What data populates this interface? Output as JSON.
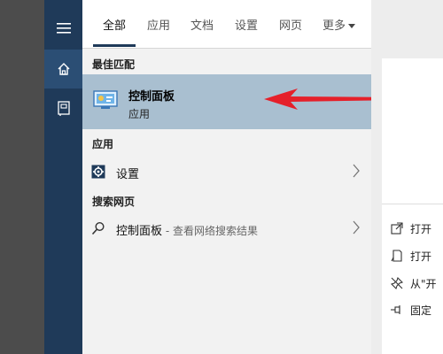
{
  "tabs": {
    "all": "全部",
    "apps": "应用",
    "docs": "文档",
    "settings": "设置",
    "web": "网页",
    "more": "更多"
  },
  "best_match": {
    "section_title": "最佳匹配",
    "name": "控制面板",
    "subtitle": "应用"
  },
  "apps_section": {
    "title": "应用",
    "items": [
      {
        "label": "设置",
        "icon": "gear-icon"
      }
    ]
  },
  "web_section": {
    "title": "搜索网页",
    "items": [
      {
        "label": "控制面板",
        "suffix": " - 查看网络搜索结果",
        "icon": "search-icon"
      }
    ]
  },
  "detail_actions": [
    {
      "label": "打开",
      "icon": "open-icon"
    },
    {
      "label": "打开",
      "icon": "file-location-icon"
    },
    {
      "label": "从\"开",
      "icon": "unpin-icon"
    },
    {
      "label": "固定",
      "icon": "pin-icon"
    }
  ],
  "colors": {
    "rail": "#1f3a59",
    "rail_active": "#2b4e74",
    "selected": "#a9bfd0",
    "arrow": "#e5202a"
  }
}
